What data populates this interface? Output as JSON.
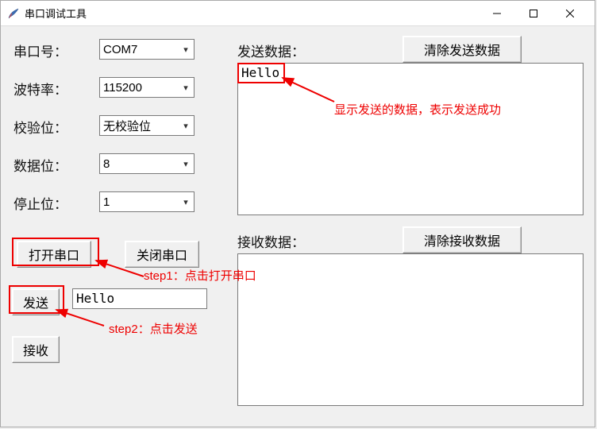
{
  "window": {
    "title": "串口调试工具"
  },
  "labels": {
    "port": "串口号：",
    "baud": "波特率：",
    "parity": "校验位：",
    "databits": "数据位：",
    "stopbits": "停止位：",
    "send_data": "发送数据：",
    "recv_data": "接收数据："
  },
  "combos": {
    "port": "COM7",
    "baud": "115200",
    "parity": "无校验位",
    "databits": "8",
    "stopbits": "1"
  },
  "buttons": {
    "open": "打开串口",
    "close": "关闭串口",
    "send": "发送",
    "recv": "接收",
    "clear_send": "清除发送数据",
    "clear_recv": "清除接收数据"
  },
  "text": {
    "send_area": "Hello",
    "send_input": "Hello",
    "recv_area": ""
  },
  "annotations": {
    "step1": "step1：点击打开串口",
    "step2": "step2：点击发送",
    "sent_hint": "显示发送的数据，表示发送成功"
  }
}
